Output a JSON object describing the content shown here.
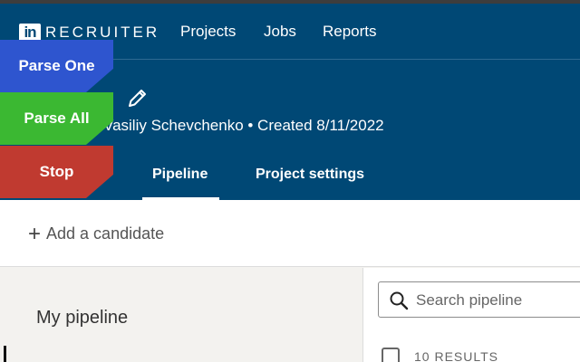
{
  "app": {
    "logo_mark": "in",
    "brand": "RECRUITER"
  },
  "nav": {
    "items": [
      {
        "label": "Projects"
      },
      {
        "label": "Jobs"
      },
      {
        "label": "Reports"
      }
    ]
  },
  "project": {
    "meta": "Vasiliy Schevchenko • Created 8/11/2022",
    "edit_icon": "pencil-icon"
  },
  "tabs": {
    "items": [
      {
        "label": "Pipeline",
        "active": true
      },
      {
        "label": "Project settings",
        "active": false
      }
    ]
  },
  "actions": {
    "add_candidate": "Add a candidate"
  },
  "sidebar": {
    "title": "My pipeline"
  },
  "pipeline": {
    "search_placeholder": "Search pipeline",
    "results_count": "10 RESULTS"
  },
  "overlay": {
    "parse_one": "Parse One",
    "parse_all": "Parse All",
    "stop": "Stop",
    "colors": {
      "parse_one": "#2e55cf",
      "parse_all": "#3bb832",
      "stop": "#c03a30"
    }
  },
  "colors": {
    "header_bg": "#004875",
    "page_bg": "#f3f2ef"
  }
}
